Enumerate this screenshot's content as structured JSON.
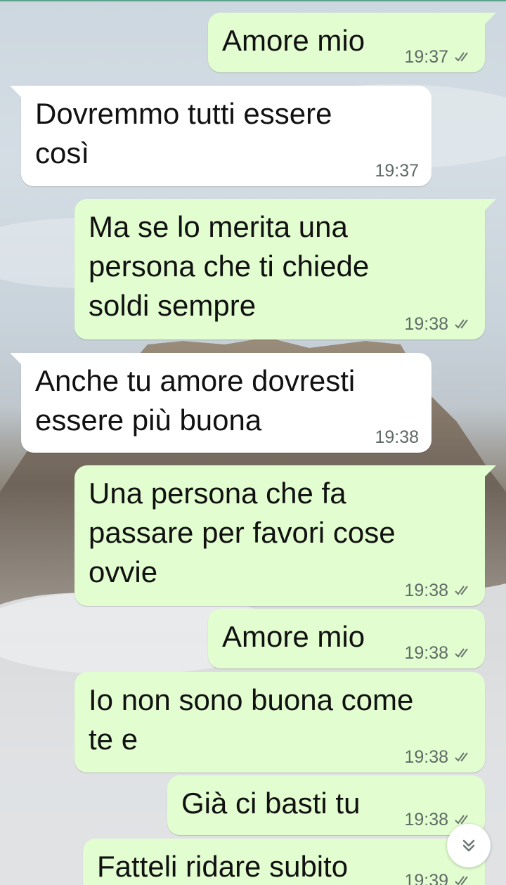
{
  "messages": [
    {
      "text": "Amore mio",
      "time": "19:37",
      "direction": "outgoing",
      "status": "read"
    },
    {
      "text": "Dovremmo tutti essere\ncosì",
      "time": "19:37",
      "direction": "incoming"
    },
    {
      "text": "Ma se lo merita una\npersona che ti chiede\nsoldi sempre",
      "time": "19:38",
      "direction": "outgoing",
      "status": "read"
    },
    {
      "text": "Anche tu amore dovresti\nessere più buona",
      "time": "19:38",
      "direction": "incoming"
    },
    {
      "text": "Una persona che fa\npassare per favori cose\novvie",
      "time": "19:38",
      "direction": "outgoing",
      "status": "read"
    },
    {
      "text": "Amore mio",
      "time": "19:38",
      "direction": "outgoing",
      "status": "read"
    },
    {
      "text": "Io non sono buona come\nte e",
      "time": "19:38",
      "direction": "outgoing",
      "status": "read"
    },
    {
      "text": "Già ci basti tu",
      "time": "19:38",
      "direction": "outgoing",
      "status": "read"
    },
    {
      "text": "Fatteli ridare subito",
      "time": "19:39",
      "direction": "outgoing",
      "status": "read"
    }
  ],
  "colors": {
    "outgoing_bubble": "#e2fdd0",
    "incoming_bubble": "#ffffff",
    "tick": "#6b7670"
  },
  "icons": {
    "read_receipt": "double-check-icon",
    "scroll_down": "double-chevron-down-icon"
  }
}
